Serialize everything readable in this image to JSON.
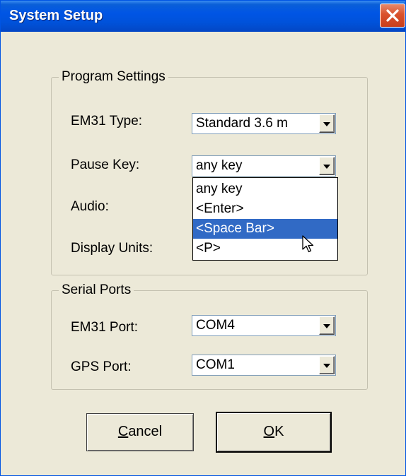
{
  "window": {
    "title": "System Setup"
  },
  "program_settings": {
    "legend": "Program Settings",
    "em31_type": {
      "label": "EM31 Type:",
      "value": "Standard 3.6 m"
    },
    "pause_key": {
      "label": "Pause Key:",
      "value": "any key",
      "options": [
        "any key",
        "<Enter>",
        "<Space Bar>",
        "<P>"
      ],
      "highlighted_index": 2
    },
    "audio": {
      "label": "Audio:"
    },
    "display_units": {
      "label": "Display Units:"
    }
  },
  "serial_ports": {
    "legend": "Serial Ports",
    "em31_port": {
      "label": "EM31 Port:",
      "value": "COM4"
    },
    "gps_port": {
      "label": "GPS Port:",
      "value": "COM1"
    }
  },
  "buttons": {
    "cancel": {
      "mnemonic": "C",
      "rest": "ancel"
    },
    "ok": {
      "mnemonic": "O",
      "rest": "K"
    }
  },
  "colors": {
    "titlebar": "#0055e5",
    "selection": "#316ac5",
    "dialog_bg": "#ece9d8",
    "close": "#d9512c"
  },
  "icons": [
    "close-icon",
    "dropdown-arrow-icon",
    "mouse-pointer-icon"
  ]
}
